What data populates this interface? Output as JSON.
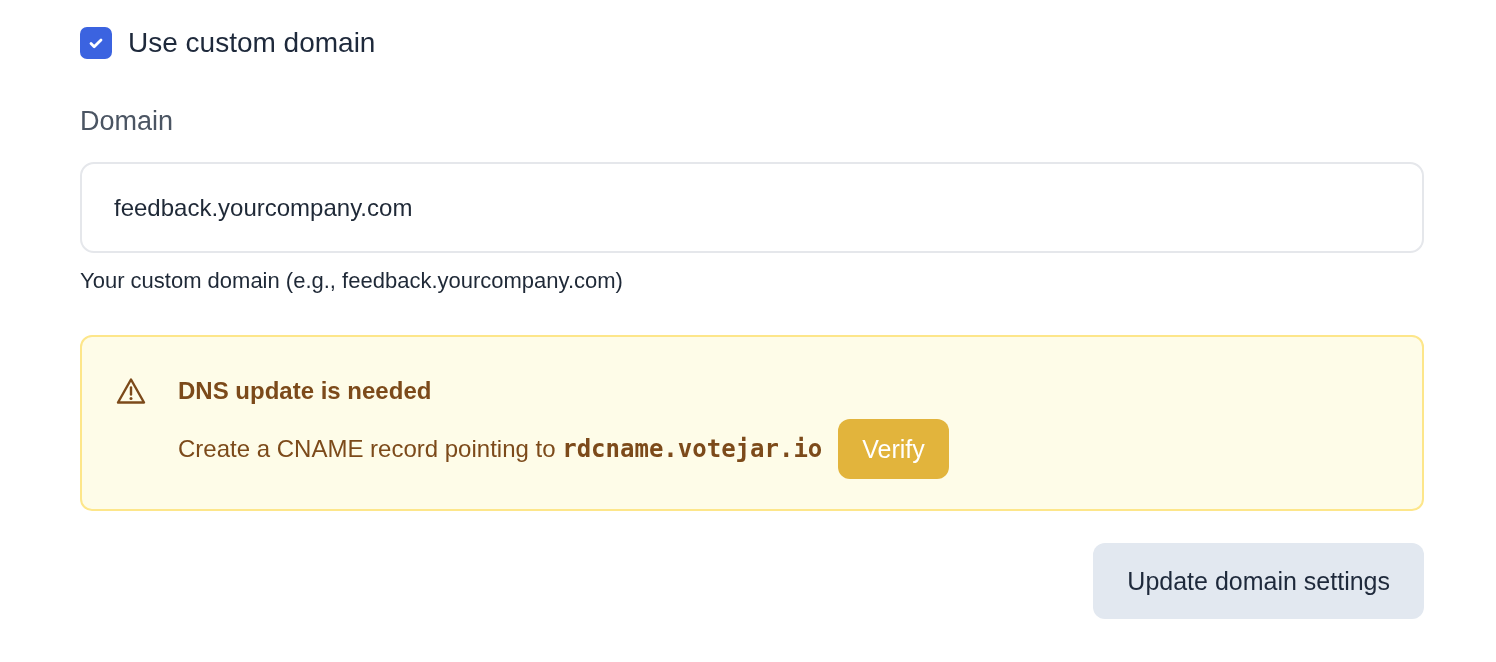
{
  "custom_domain": {
    "label": "Use custom domain",
    "checked": true
  },
  "domain_field": {
    "label": "Domain",
    "value": "feedback.yourcompany.com",
    "help": "Your custom domain (e.g., feedback.yourcompany.com)"
  },
  "alert": {
    "title": "DNS update is needed",
    "message": "Create a CNAME record pointing to **rdcname.votejar.io**",
    "action": "Verify"
  },
  "buttons": [
    "Update domain settings"
  ]
}
